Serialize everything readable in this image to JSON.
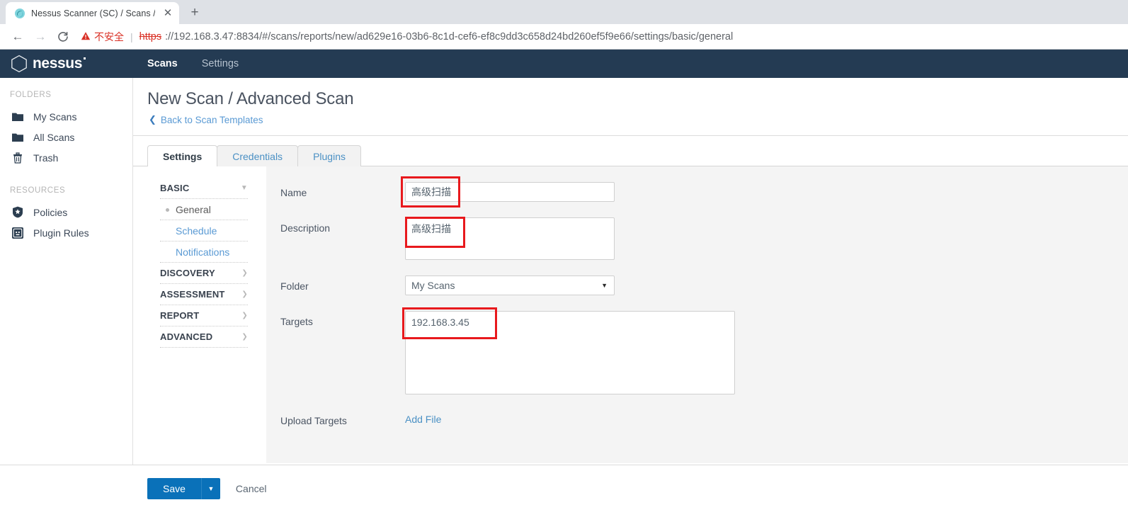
{
  "browser": {
    "tab": {
      "title": "Nessus Scanner (SC) / Scans / ",
      "favicon_icon": "nessus-swirl-icon",
      "close_icon": "close-icon"
    },
    "new_tab_label": "+",
    "nav": {
      "back_icon": "arrow-left-icon",
      "forward_icon": "arrow-right-icon",
      "reload_icon": "reload-icon"
    },
    "omnibox": {
      "warning_icon": "warning-triangle-icon",
      "warning_text": "不安全",
      "separator": "|",
      "url_scheme": "https",
      "url_rest": "://192.168.3.47:8834/#/scans/reports/new/ad629e16-03b6-8c1d-cef6-ef8c9dd3c658d24bd260ef5f9e66/settings/basic/general"
    }
  },
  "topbar": {
    "brand": "nessus",
    "brand_icon": "hexagon-logo-icon",
    "nav": [
      {
        "label": "Scans",
        "active": true
      },
      {
        "label": "Settings",
        "active": false
      }
    ]
  },
  "sidebar": {
    "sections": [
      {
        "heading": "FOLDERS",
        "items": [
          {
            "label": "My Scans",
            "icon": "folder-icon"
          },
          {
            "label": "All Scans",
            "icon": "folder-icon"
          },
          {
            "label": "Trash",
            "icon": "trash-icon"
          }
        ]
      },
      {
        "heading": "RESOURCES",
        "items": [
          {
            "label": "Policies",
            "icon": "shield-star-icon"
          },
          {
            "label": "Plugin Rules",
            "icon": "plugin-rules-icon"
          }
        ]
      }
    ]
  },
  "page": {
    "title": "New Scan / Advanced Scan",
    "back_link": "Back to Scan Templates",
    "back_icon": "chevron-left-icon"
  },
  "tabs": [
    {
      "label": "Settings",
      "active": true
    },
    {
      "label": "Credentials",
      "active": false
    },
    {
      "label": "Plugins",
      "active": false
    }
  ],
  "settings_nav": [
    {
      "label": "BASIC",
      "type": "group",
      "caret": "chevron-down-icon"
    },
    {
      "label": "General",
      "type": "sub",
      "active": true
    },
    {
      "label": "Schedule",
      "type": "sub",
      "active": false
    },
    {
      "label": "Notifications",
      "type": "sub",
      "active": false
    },
    {
      "label": "DISCOVERY",
      "type": "group",
      "caret": "chevron-right-icon"
    },
    {
      "label": "ASSESSMENT",
      "type": "group",
      "caret": "chevron-right-icon"
    },
    {
      "label": "REPORT",
      "type": "group",
      "caret": "chevron-right-icon"
    },
    {
      "label": "ADVANCED",
      "type": "group",
      "caret": "chevron-right-icon"
    }
  ],
  "form": {
    "name": {
      "label": "Name",
      "value": "高级扫描"
    },
    "description": {
      "label": "Description",
      "value": "高级扫描"
    },
    "folder": {
      "label": "Folder",
      "value": "My Scans",
      "caret": "chevron-down-icon"
    },
    "targets": {
      "label": "Targets",
      "value": "192.168.3.45"
    },
    "upload_targets": {
      "label": "Upload Targets",
      "link": "Add File"
    }
  },
  "footer": {
    "save_label": "Save",
    "save_caret": "chevron-down-icon",
    "cancel_label": "Cancel"
  },
  "colors": {
    "topbar_bg": "#243b53",
    "primary_button": "#0a71b9",
    "link": "#4a90c4",
    "annotation_red": "#e8191d",
    "panel_bg": "#f4f4f4",
    "warning_red": "#d93025"
  }
}
